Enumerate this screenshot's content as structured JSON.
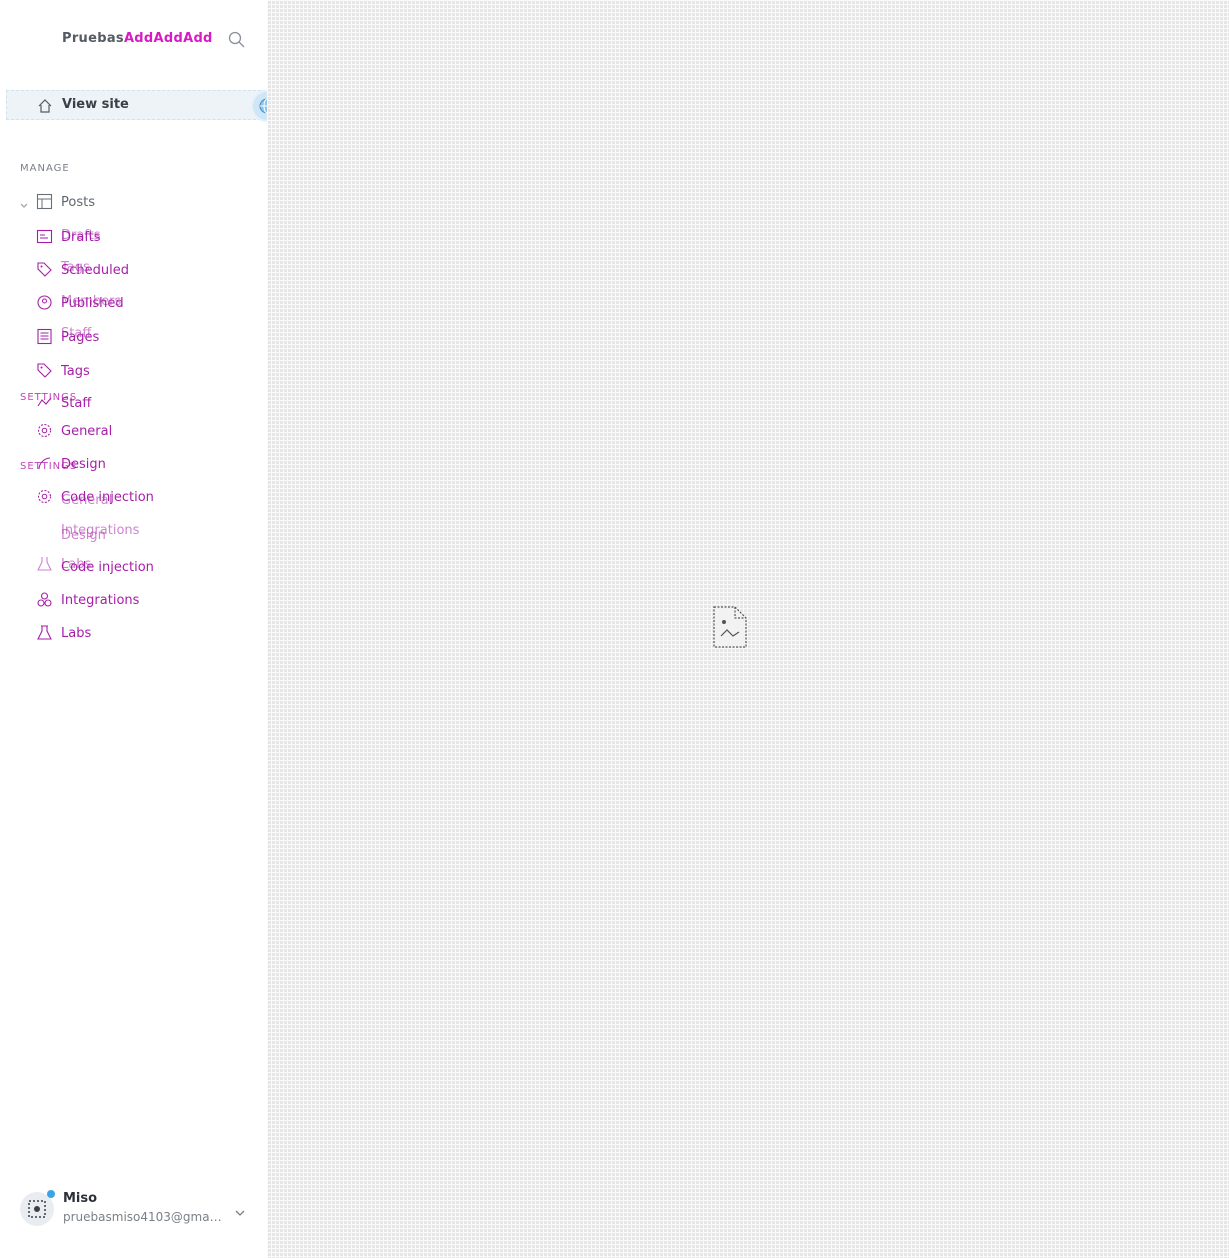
{
  "brand": {
    "part1": "Pruebas",
    "part2": "AddAddAdd"
  },
  "header": {
    "view_site_label": "View site"
  },
  "manage": {
    "section_label": "MANAGE",
    "items": [
      {
        "label": "Posts",
        "icon": "posts-icon"
      },
      {
        "label": "Drafts",
        "icon": "drafts-icon"
      },
      {
        "label": "Scheduled",
        "icon": "tag-icon"
      },
      {
        "label": "Published",
        "icon": "members-icon"
      },
      {
        "label": "Pages",
        "icon": "pages-icon"
      },
      {
        "label": "Tags",
        "icon": "tag-icon"
      },
      {
        "label": "Staff",
        "icon": "staff-icon"
      },
      {
        "label": "General",
        "icon": "gear-icon"
      },
      {
        "label": "Design",
        "icon": "design-icon"
      },
      {
        "label": "Code injection",
        "icon": "code-icon"
      },
      {
        "label": "Integrations",
        "icon": "integrations-icon"
      },
      {
        "label": "Labs",
        "icon": "labs-icon"
      }
    ]
  },
  "ghost_overlay": {
    "settings_label_1": "SETTINGS",
    "settings_label_2": "SETTINGS",
    "items": [
      {
        "label": "Drafts"
      },
      {
        "label": "Tags"
      },
      {
        "label": "Members"
      },
      {
        "label": "Staff"
      },
      {
        "label": "General"
      },
      {
        "label": "Design"
      },
      {
        "label": "Integrations"
      },
      {
        "label": "Labs"
      }
    ]
  },
  "user": {
    "name": "Miso",
    "email": "pruebasmiso4103@gmai..."
  }
}
